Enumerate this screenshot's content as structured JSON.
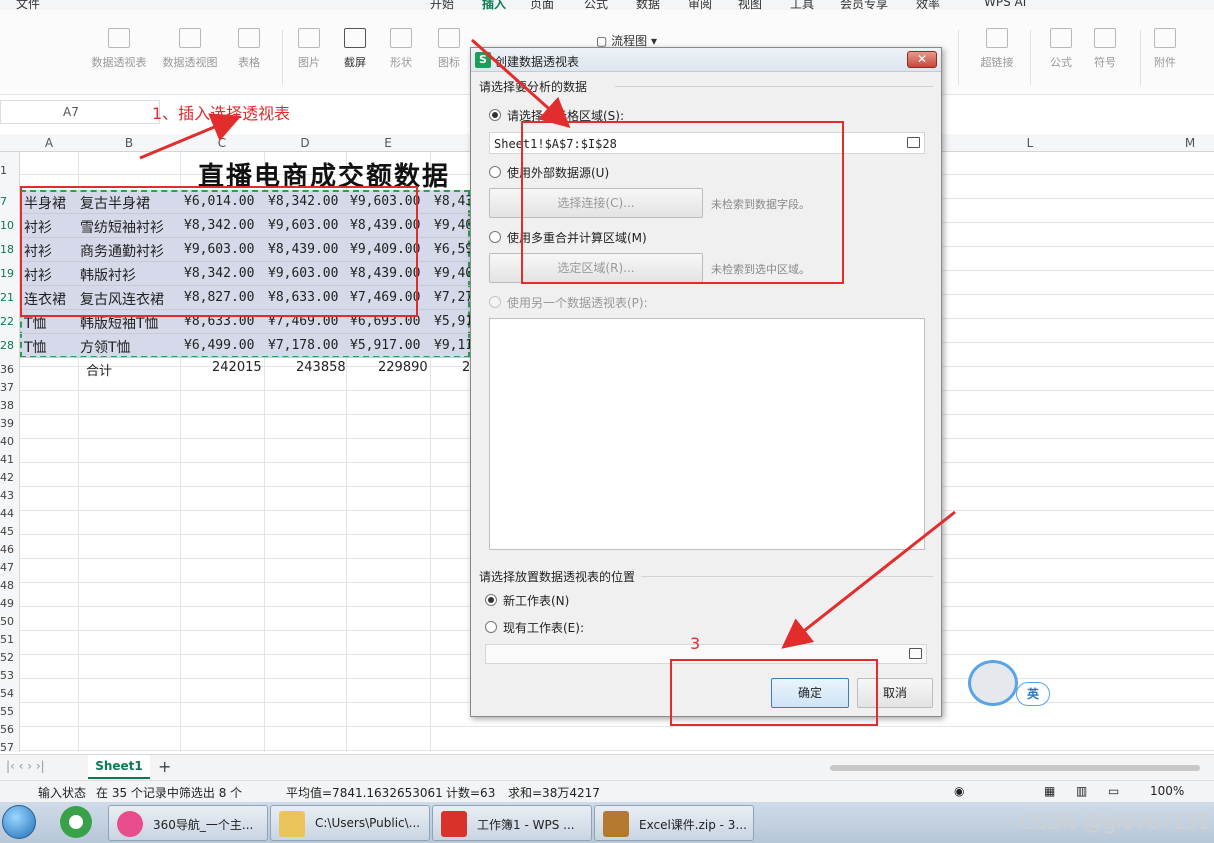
{
  "menu": {
    "tabs": [
      "文件",
      "开始",
      "插入",
      "页面",
      "公式",
      "数据",
      "审阅",
      "视图",
      "工具",
      "会员专享",
      "效率",
      "WPS AI"
    ],
    "active": "插入"
  },
  "ribbon": {
    "pivot_table": "数据透视表",
    "pivot_chart": "数据透视图",
    "table": "表格",
    "picture": "图片",
    "screenshot": "截屏",
    "shape": "形状",
    "icon": "图标",
    "flowchart": "流程图",
    "hyperlink": "超链接",
    "formula": "公式",
    "symbol": "符号",
    "attachment": "附件"
  },
  "namebox": "A7",
  "columns": [
    "A",
    "B",
    "C",
    "D",
    "E",
    "L",
    "M"
  ],
  "row_numbers": [
    "1",
    "7",
    "10",
    "18",
    "19",
    "21",
    "22",
    "28",
    "36",
    "37",
    "38",
    "39",
    "40",
    "41",
    "42",
    "43",
    "44",
    "45",
    "46",
    "47",
    "48",
    "49",
    "50",
    "51",
    "52",
    "53",
    "54",
    "55",
    "56",
    "57"
  ],
  "sheet_title": "直播电商成交额数据",
  "rows": [
    {
      "cat": "半身裙",
      "name": "复古半身裙",
      "c": "¥6,014.00",
      "d": "¥8,342.00",
      "e": "¥9,603.00",
      "f": "¥8,43"
    },
    {
      "cat": "衬衫",
      "name": "雪纺短袖衬衫",
      "c": "¥8,342.00",
      "d": "¥9,603.00",
      "e": "¥8,439.00",
      "f": "¥9,40"
    },
    {
      "cat": "衬衫",
      "name": "商务通勤衬衫",
      "c": "¥9,603.00",
      "d": "¥8,439.00",
      "e": "¥9,409.00",
      "f": "¥6,59"
    },
    {
      "cat": "衬衫",
      "name": "韩版衬衫",
      "c": "¥8,342.00",
      "d": "¥9,603.00",
      "e": "¥8,439.00",
      "f": "¥9,40"
    },
    {
      "cat": "连衣裙",
      "name": "复古风连衣裙",
      "c": "¥8,827.00",
      "d": "¥8,633.00",
      "e": "¥7,469.00",
      "f": "¥7,27"
    },
    {
      "cat": "T恤",
      "name": "韩版短袖T恤",
      "c": "¥8,633.00",
      "d": "¥7,469.00",
      "e": "¥6,693.00",
      "f": "¥5,91"
    },
    {
      "cat": "T恤",
      "name": "方领T恤",
      "c": "¥6,499.00",
      "d": "¥7,178.00",
      "e": "¥5,917.00",
      "f": "¥9,11"
    }
  ],
  "totals": {
    "label": "合计",
    "c": "242015",
    "d": "243858",
    "e": "229890",
    "f": "2"
  },
  "dialog": {
    "title": "创建数据透视表",
    "section1": "请选择要分析的数据",
    "opt_range": "请选择单元格区域(S):",
    "range_value": "Sheet1!$A$7:$I$28",
    "opt_external": "使用外部数据源(U)",
    "btn_connect": "选择连接(C)...",
    "hint_connect": "未检索到数据字段。",
    "opt_multi": "使用多重合并计算区域(M)",
    "btn_region": "选定区域(R)...",
    "hint_region": "未检索到选中区域。",
    "opt_other": "使用另一个数据透视表(P):",
    "section2": "请选择放置数据透视表的位置",
    "opt_new": "新工作表(N)",
    "opt_existing": "现有工作表(E):",
    "ok": "确定",
    "cancel": "取消"
  },
  "annotations": {
    "step1": "1、插入选择透视表",
    "step3": "3"
  },
  "sheet_tab": "Sheet1",
  "status": {
    "mode": "输入状态",
    "filter": "在 35 个记录中筛选出 8 个",
    "average": "平均值=7841.1632653061",
    "count": "计数=63",
    "sum": "求和=38万4217",
    "zoom": "100%"
  },
  "taskbar": [
    "360导航_一个主...",
    "C:\\Users\\Public\\...",
    "工作簿1 - WPS ...",
    "Excel课件.zip - 3..."
  ],
  "assistant_label": "英",
  "watermark": "CSDN @gl0707131",
  "colors": {
    "accent": "#0b7a4f",
    "annotation": "#e32d2d",
    "selection": "#c6cbe0"
  }
}
